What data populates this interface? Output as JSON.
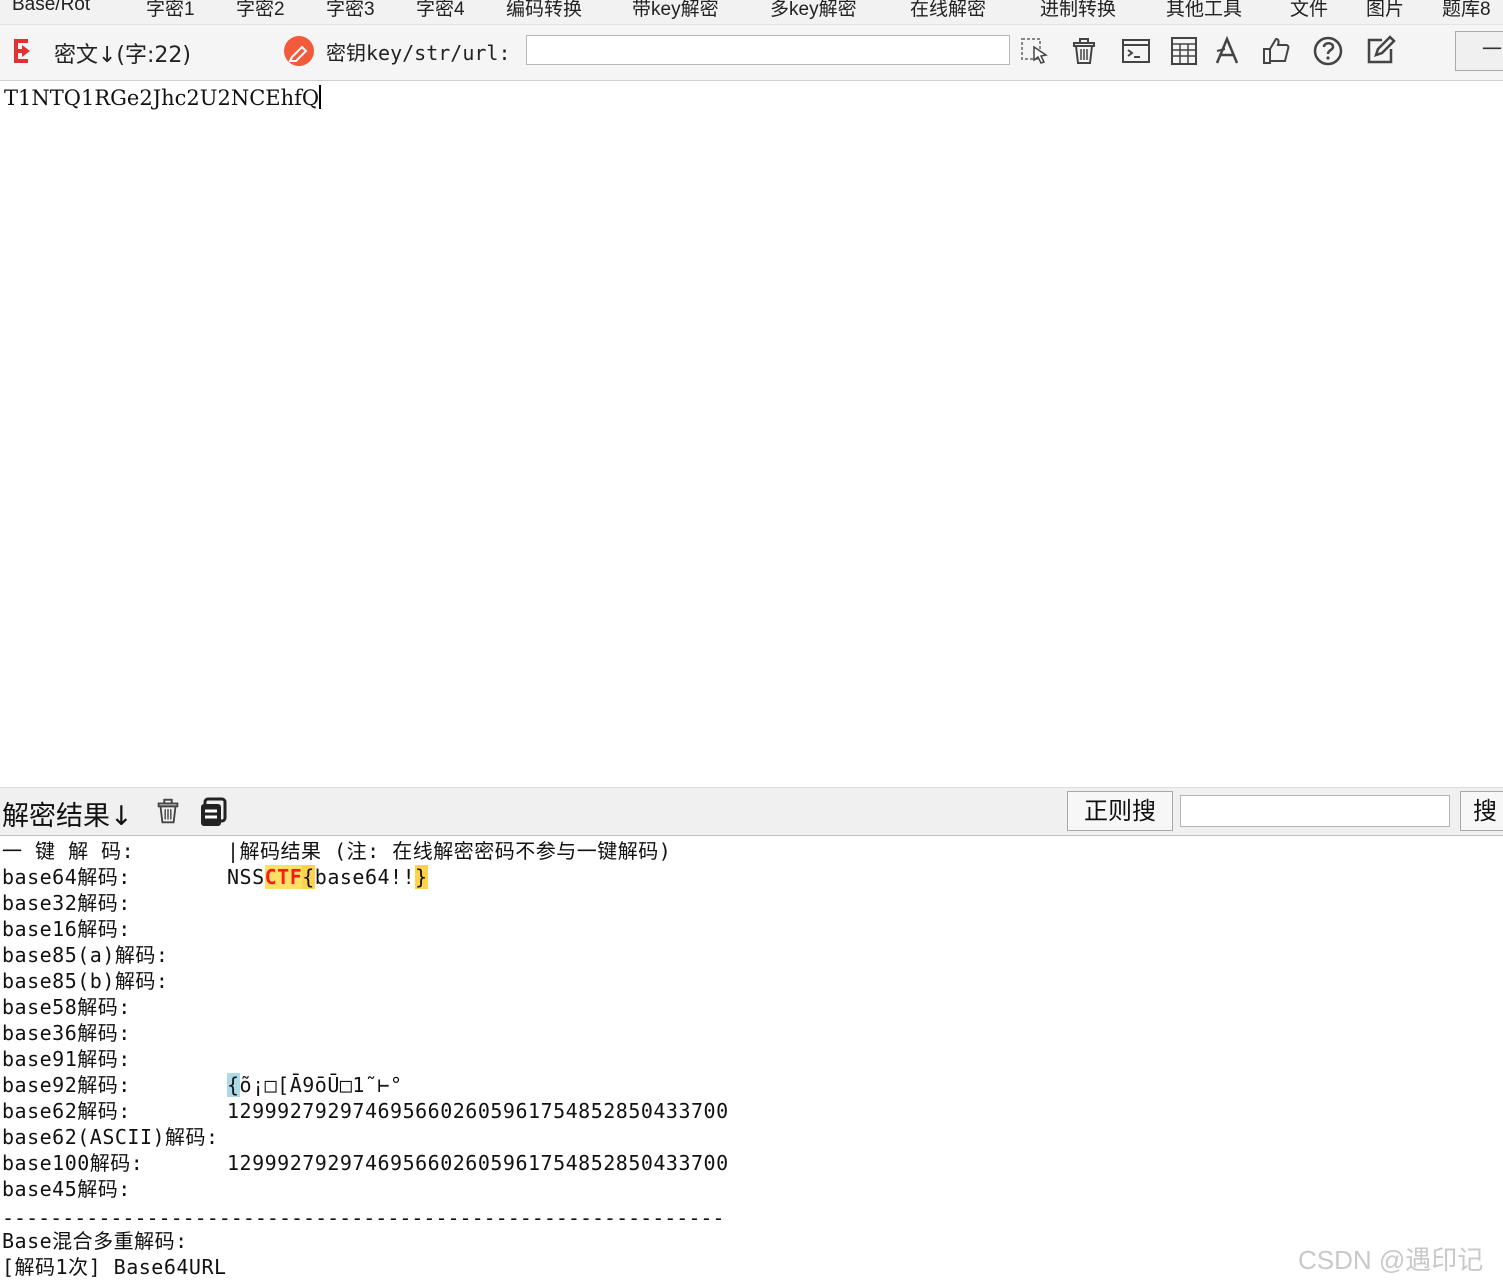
{
  "menu": {
    "items": [
      "Base/Rot",
      "字密1",
      "字密2",
      "字密3",
      "字密4",
      "编码转换",
      "带key解密",
      "多key解密",
      "在线解密",
      "进制转换",
      "其他工具",
      "文件",
      "图片",
      "题库8"
    ]
  },
  "toolbar": {
    "cipher_label": "密文↓(字:22)",
    "key_label": "密钥key/str/url:",
    "key_value": "",
    "right_button": "一",
    "icons": [
      "select-pointer-icon",
      "trash-icon",
      "terminal-icon",
      "calculator-icon",
      "font-icon",
      "thumbs-up-icon",
      "help-icon",
      "edit-icon"
    ]
  },
  "cipher": {
    "text": "T1NTQ1RGe2Jhc2U2NCEhfQ"
  },
  "result_header": {
    "title": "解密结果↓",
    "regex_button": "正则搜",
    "regex_value": "",
    "search_button": "搜"
  },
  "results": {
    "header_label": "一 键 解 码:",
    "header_value": "|解码结果 (注: 在线解密密码不参与一键解码)",
    "rows": [
      {
        "label": "base64解码:",
        "prefix": "NSS",
        "ctf": "CTF",
        "open": "{",
        "mid": "base64!!",
        "close": "}"
      },
      {
        "label": "base32解码:",
        "value": ""
      },
      {
        "label": "base16解码:",
        "value": ""
      },
      {
        "label": "base85(a)解码:",
        "value": ""
      },
      {
        "label": "base85(b)解码:",
        "value": ""
      },
      {
        "label": "base58解码:",
        "value": ""
      },
      {
        "label": "base36解码:",
        "value": ""
      },
      {
        "label": "base91解码:",
        "value": ""
      },
      {
        "label": "base92解码:",
        "open": "{",
        "value": "õ¡□[Ā9ōŪ□1˜⊢°"
      },
      {
        "label": "base62解码:",
        "value": "12999279297469566026059617548528504337​00"
      },
      {
        "label": "base62(ASCII)解码:",
        "value": ""
      },
      {
        "label": "base100解码:",
        "value": "12999279297469566026059617548528504337​00"
      },
      {
        "label": "base45解码:",
        "value": ""
      }
    ],
    "separator": "------------------------------------------------------------",
    "mixed_label": "Base混合多重解码:",
    "mixed_line": "[解码1次] Base64URL"
  },
  "watermark": "CSDN @遇印记"
}
